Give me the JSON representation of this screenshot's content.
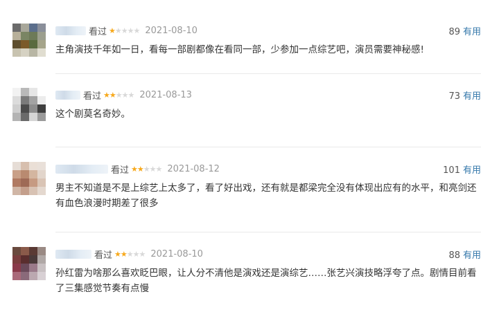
{
  "reviews": [
    {
      "watched": "看过",
      "rating": 1,
      "max_rating": 5,
      "date": "2021-08-10",
      "useful_count": "89",
      "useful_label": "有用",
      "content": "主角演技千年如一日，看每一部剧都像在看同一部，少参加一点综艺吧，演员需要神秘感!",
      "avatar_colors": [
        "#6b6b6b",
        "#a8a79a",
        "#5b6e8c",
        "#8a8f9a",
        "#b8b09a",
        "#7a8564",
        "#6d7a58",
        "#9c9f8e",
        "#5e4e2e",
        "#7b5a2a",
        "#5a6a3e",
        "#a5a48a",
        "#c8c3b0",
        "#d6d2c3",
        "#b8b6a4",
        "#e0ddd0"
      ]
    },
    {
      "watched": "看过",
      "rating": 2,
      "max_rating": 5,
      "date": "2021-08-13",
      "useful_count": "73",
      "useful_label": "有用",
      "content": "这个剧莫名奇妙。",
      "avatar_colors": [
        "#f2f2f2",
        "#b9b9b9",
        "#e6e6e6",
        "#ffffff",
        "#dcdcdc",
        "#7a7a7a",
        "#a3a3a3",
        "#ececec",
        "#cfcfcf",
        "#4b4b4b",
        "#8d8d8d",
        "#3e3e3e",
        "#b4b4b4",
        "#6a6a6a",
        "#d5d5d5",
        "#9a9a9a"
      ]
    },
    {
      "watched": "看过",
      "rating": 2,
      "max_rating": 5,
      "date": "2021-08-12",
      "useful_count": "101",
      "useful_label": "有用",
      "content": "男主不知道是不是上综艺上太多了，看了好出戏，还有就是都梁完全没有体现出应有的水平，和亮剑还有血色浪漫时期差了很多",
      "avatar_colors": [
        "#e6ddd6",
        "#d7bfae",
        "#eadfd6",
        "#e9e0d9",
        "#c9a088",
        "#b98a70",
        "#d4b6a0",
        "#e2d5cb",
        "#b07a62",
        "#9e6a56",
        "#c69a82",
        "#d9c4b5",
        "#d0b6a6",
        "#c49f8c",
        "#d8c2b3",
        "#e4d8cf"
      ]
    },
    {
      "watched": "看过",
      "rating": 2,
      "max_rating": 5,
      "date": "2021-08-10",
      "useful_count": "88",
      "useful_label": "有用",
      "content": "孙红雷为啥那么喜欢眨巴眼，让人分不清他是演戏还是演综艺……张艺兴演技略浮夸了点。剧情目前看了三集感觉节奏有点慢",
      "avatar_colors": [
        "#6a4a3e",
        "#8a5a4a",
        "#5a3a34",
        "#9a8a84",
        "#7a3e3e",
        "#5a2e2e",
        "#4a3a3a",
        "#b0a8a6",
        "#8a3a4a",
        "#6a4a5a",
        "#9a7a8a",
        "#c8c0c2",
        "#aa6a7a",
        "#8a6a7a",
        "#bba8b0",
        "#d8d0d4"
      ]
    }
  ]
}
